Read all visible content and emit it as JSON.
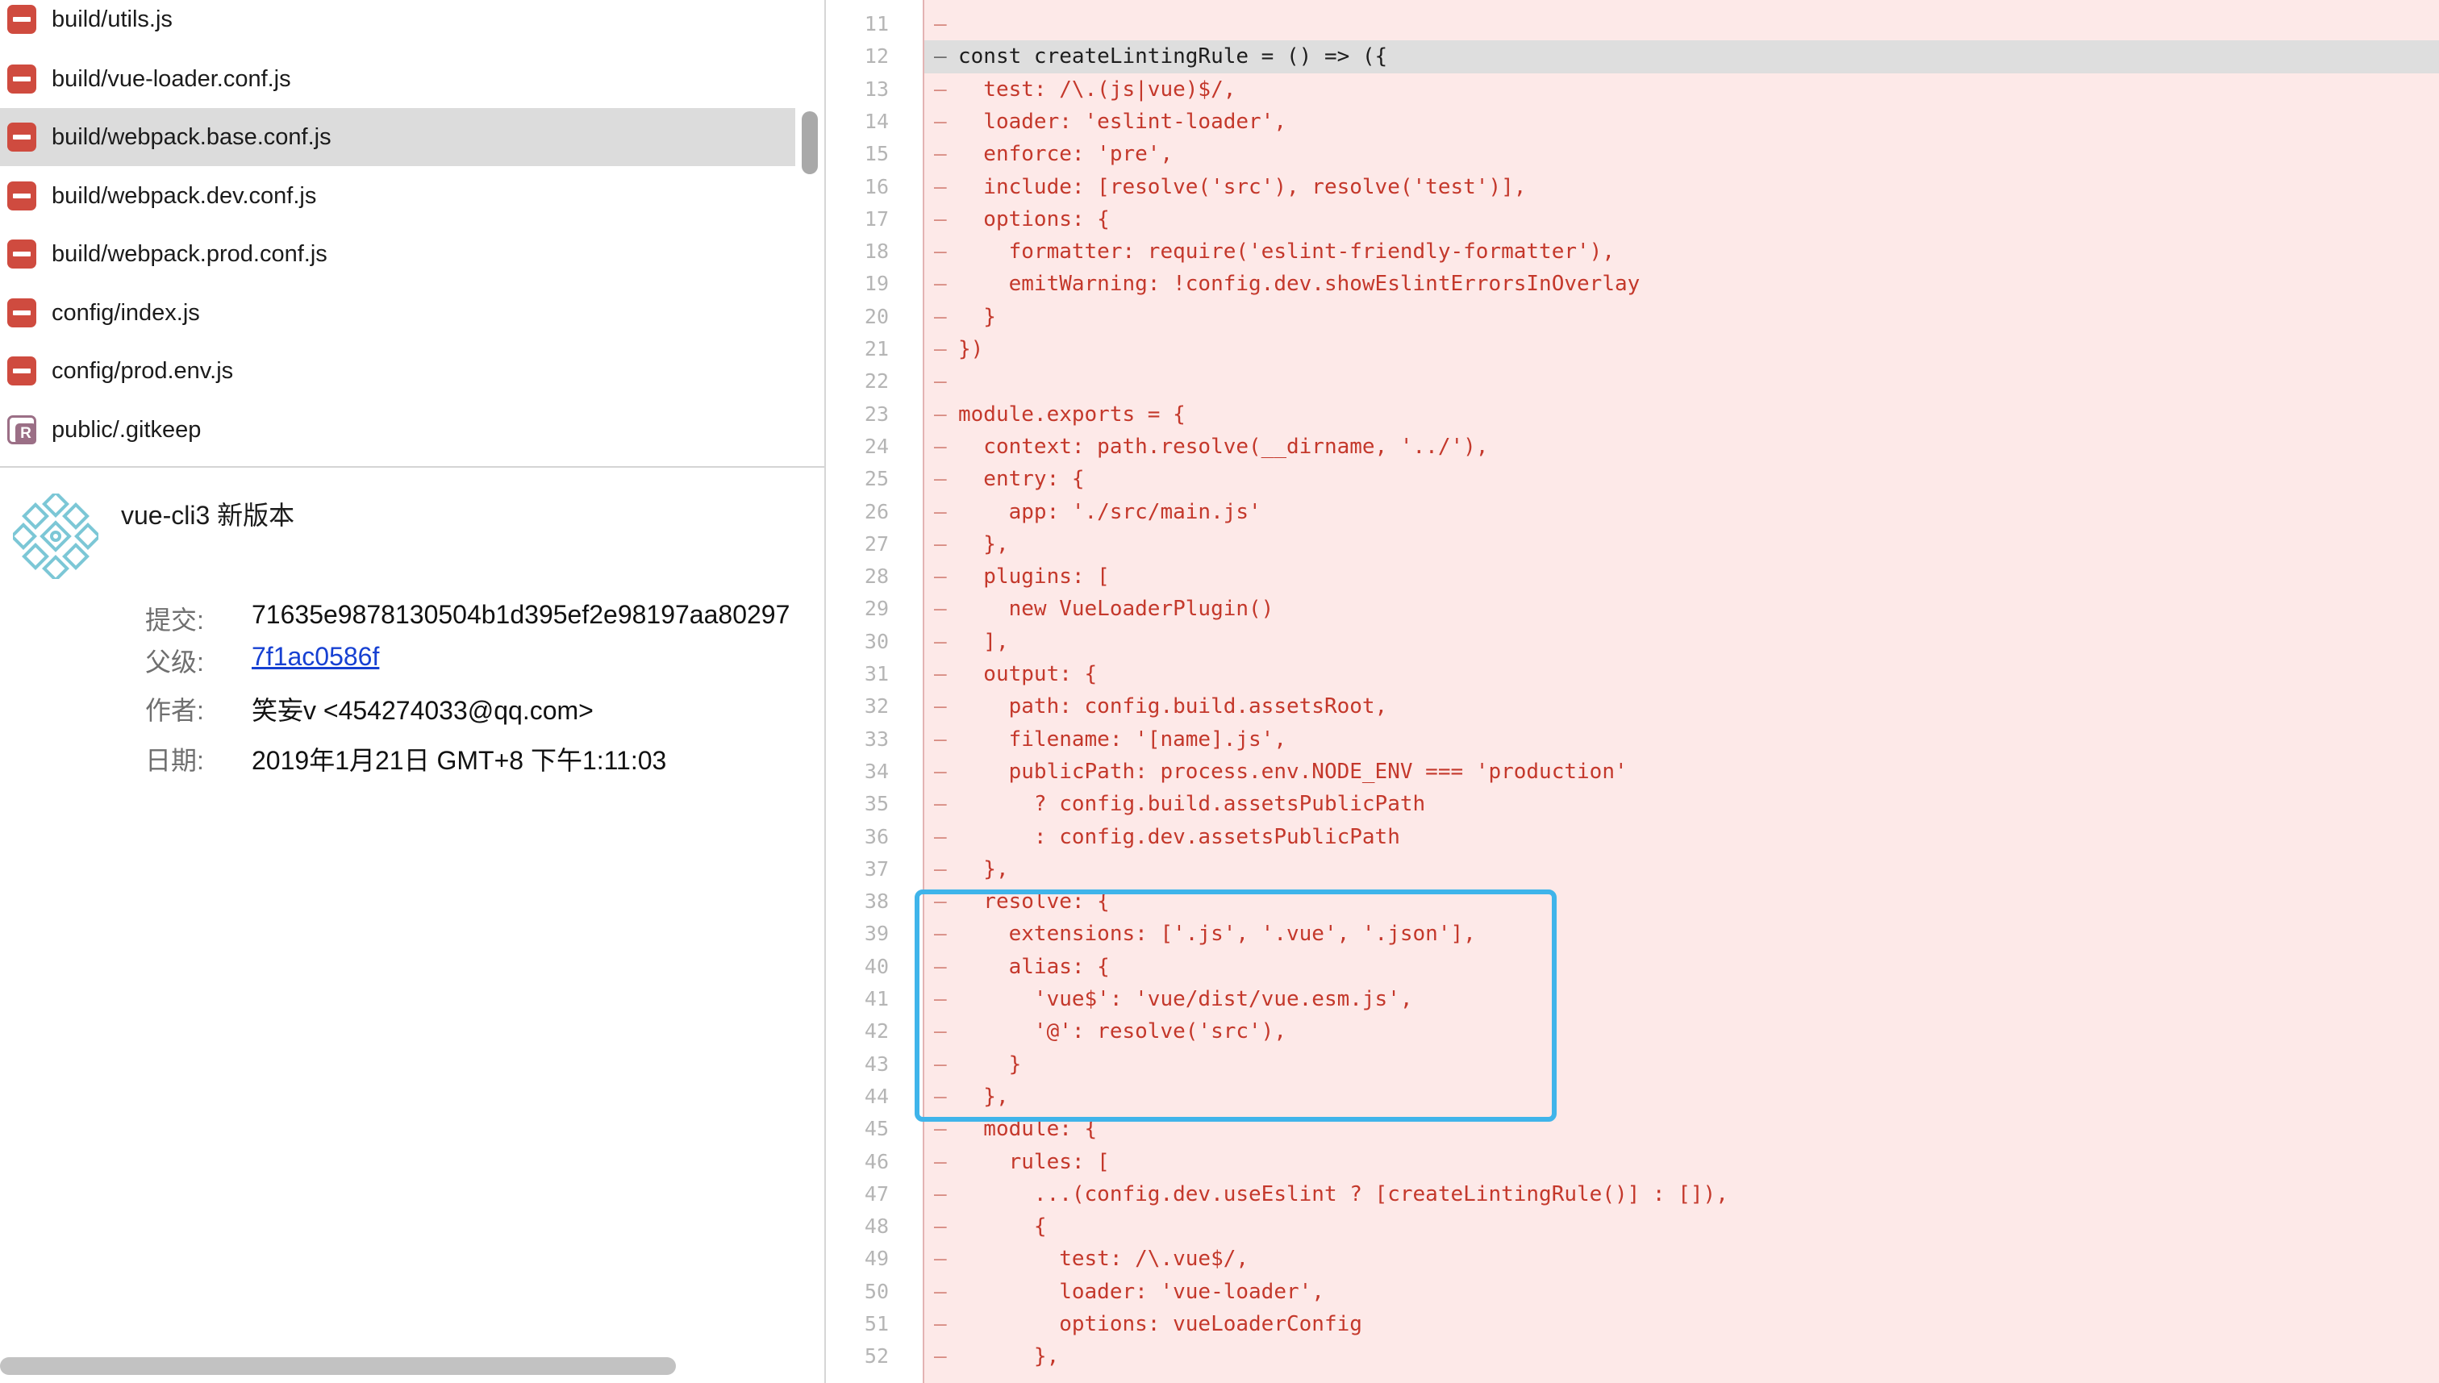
{
  "file_list": {
    "items": [
      {
        "status": "deleted",
        "name": "build/utils.js",
        "selected": false
      },
      {
        "status": "deleted",
        "name": "build/vue-loader.conf.js",
        "selected": false
      },
      {
        "status": "deleted",
        "name": "build/webpack.base.conf.js",
        "selected": true
      },
      {
        "status": "deleted",
        "name": "build/webpack.dev.conf.js",
        "selected": false
      },
      {
        "status": "deleted",
        "name": "build/webpack.prod.conf.js",
        "selected": false
      },
      {
        "status": "deleted",
        "name": "config/index.js",
        "selected": false
      },
      {
        "status": "deleted",
        "name": "config/prod.env.js",
        "selected": false
      },
      {
        "status": "renamed",
        "name": "public/.gitkeep",
        "selected": false
      }
    ],
    "renamed_letter": "R"
  },
  "commit": {
    "title": "vue-cli3 新版本",
    "commit_label": "提交:",
    "commit_hash": "71635e9878130504b1d395ef2e98197aa80297",
    "parent_label": "父级:",
    "parent_hash": "7f1ac0586f",
    "author_label": "作者:",
    "author": "笑妄v <454274033@qq.com>",
    "date_label": "日期:",
    "date": "2019年1月21日 GMT+8 下午1:11:03"
  },
  "diff": {
    "marker": "–",
    "highlighted_line": 12,
    "lines": [
      {
        "n": "11",
        "code": ""
      },
      {
        "n": "12",
        "code": "const createLintingRule = () => ({"
      },
      {
        "n": "13",
        "code": "  test: /\\.(js|vue)$/,"
      },
      {
        "n": "14",
        "code": "  loader: 'eslint-loader',"
      },
      {
        "n": "15",
        "code": "  enforce: 'pre',"
      },
      {
        "n": "16",
        "code": "  include: [resolve('src'), resolve('test')],"
      },
      {
        "n": "17",
        "code": "  options: {"
      },
      {
        "n": "18",
        "code": "    formatter: require('eslint-friendly-formatter'),"
      },
      {
        "n": "19",
        "code": "    emitWarning: !config.dev.showEslintErrorsInOverlay"
      },
      {
        "n": "20",
        "code": "  }"
      },
      {
        "n": "21",
        "code": "})"
      },
      {
        "n": "22",
        "code": ""
      },
      {
        "n": "23",
        "code": "module.exports = {"
      },
      {
        "n": "24",
        "code": "  context: path.resolve(__dirname, '../'),"
      },
      {
        "n": "25",
        "code": "  entry: {"
      },
      {
        "n": "26",
        "code": "    app: './src/main.js'"
      },
      {
        "n": "27",
        "code": "  },"
      },
      {
        "n": "28",
        "code": "  plugins: ["
      },
      {
        "n": "29",
        "code": "    new VueLoaderPlugin()"
      },
      {
        "n": "30",
        "code": "  ],"
      },
      {
        "n": "31",
        "code": "  output: {"
      },
      {
        "n": "32",
        "code": "    path: config.build.assetsRoot,"
      },
      {
        "n": "33",
        "code": "    filename: '[name].js',"
      },
      {
        "n": "34",
        "code": "    publicPath: process.env.NODE_ENV === 'production'"
      },
      {
        "n": "35",
        "code": "      ? config.build.assetsPublicPath"
      },
      {
        "n": "36",
        "code": "      : config.dev.assetsPublicPath"
      },
      {
        "n": "37",
        "code": "  },"
      },
      {
        "n": "38",
        "code": "  resolve: {"
      },
      {
        "n": "39",
        "code": "    extensions: ['.js', '.vue', '.json'],"
      },
      {
        "n": "40",
        "code": "    alias: {"
      },
      {
        "n": "41",
        "code": "      'vue$': 'vue/dist/vue.esm.js',"
      },
      {
        "n": "42",
        "code": "      '@': resolve('src'),"
      },
      {
        "n": "43",
        "code": "    }"
      },
      {
        "n": "44",
        "code": "  },"
      },
      {
        "n": "45",
        "code": "  module: {"
      },
      {
        "n": "46",
        "code": "    rules: ["
      },
      {
        "n": "47",
        "code": "      ...(config.dev.useEslint ? [createLintingRule()] : []),"
      },
      {
        "n": "48",
        "code": "      {"
      },
      {
        "n": "49",
        "code": "        test: /\\.vue$/,"
      },
      {
        "n": "50",
        "code": "        loader: 'vue-loader',"
      },
      {
        "n": "51",
        "code": "        options: vueLoaderConfig"
      },
      {
        "n": "52",
        "code": "      },"
      }
    ]
  },
  "colors": {
    "deleted_icon": "#cf4b3f",
    "renamed_icon": "#9b6f86",
    "removed_code": "#c4382b",
    "removed_background": "#fde9e8",
    "annotation_box": "#3fb4ea",
    "link": "#1640d2"
  }
}
